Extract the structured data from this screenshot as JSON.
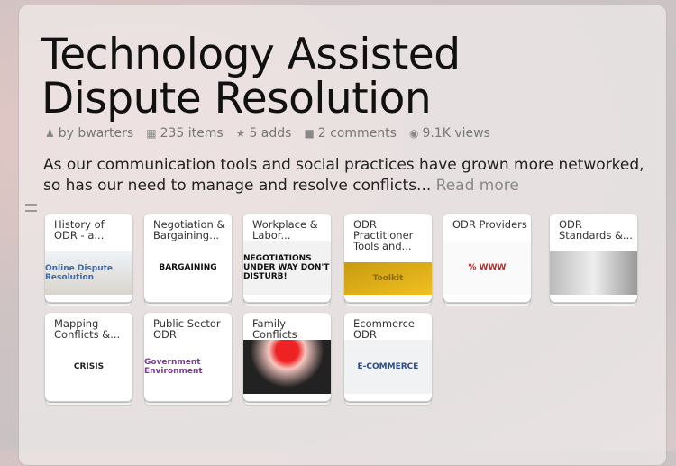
{
  "title": [
    "Technology Assisted",
    "Dispute Resolution"
  ],
  "meta": {
    "author": "by bwarters",
    "items": "235 items",
    "adds": "5 adds",
    "comments": "2 comments",
    "views": "9.1K views"
  },
  "description": "As our communication tools and social practices have grown more networked, so has our need to manage and resolve conflicts...",
  "read_more": "Read more",
  "cards": [
    {
      "label": "History of ODR - a...",
      "image_text": "Online Dispute Resolution"
    },
    {
      "label": "Negotiation & Bargaining...",
      "image_text": "BARGAINING"
    },
    {
      "label": "Workplace & Labor...",
      "image_text": "NEGOTIATIONS UNDER WAY DON'T DISTURB!"
    },
    {
      "label": "ODR Practitioner Tools and...",
      "image_text": "Toolkit"
    },
    {
      "label": "ODR Providers",
      "image_text": "% WWW"
    },
    {
      "label": "ODR Standards &...",
      "image_text": ""
    },
    {
      "label": "Mapping Conflicts &...",
      "image_text": "CRISIS"
    },
    {
      "label": "Public Sector ODR",
      "image_text": "Government Environment"
    },
    {
      "label": "Family Conflicts",
      "image_text": ""
    },
    {
      "label": "Ecommerce ODR",
      "image_text": "E-COMMERCE"
    }
  ]
}
